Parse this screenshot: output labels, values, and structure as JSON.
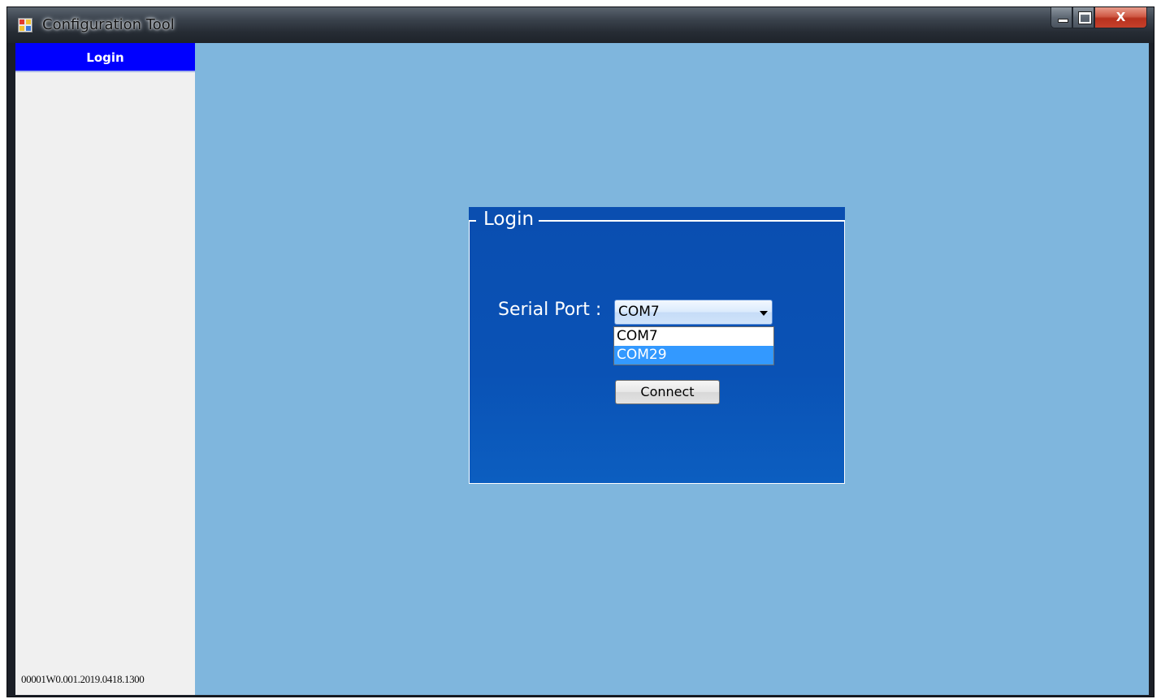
{
  "window": {
    "title": "Configuration Tool",
    "app_icon": "app-window-icon",
    "caption_buttons": {
      "minimize_icon": "minimize-icon",
      "maximize_icon": "maximize-icon",
      "close_glyph": "X"
    }
  },
  "sidebar": {
    "header_label": "Login",
    "version": "00001W0.001.2019.0418.1300"
  },
  "login_panel": {
    "legend": "Login",
    "serial_port_label": "Serial Port :",
    "serial_port": {
      "selected_value": "COM7",
      "options": [
        "COM7",
        "COM29"
      ],
      "highlighted_option": "COM29"
    },
    "connect_label": "Connect"
  },
  "colors": {
    "sidebar_header": "#0000ff",
    "client_background": "#7fb6dd",
    "panel_background": "#0a4eb0",
    "highlight": "#3399ff"
  }
}
